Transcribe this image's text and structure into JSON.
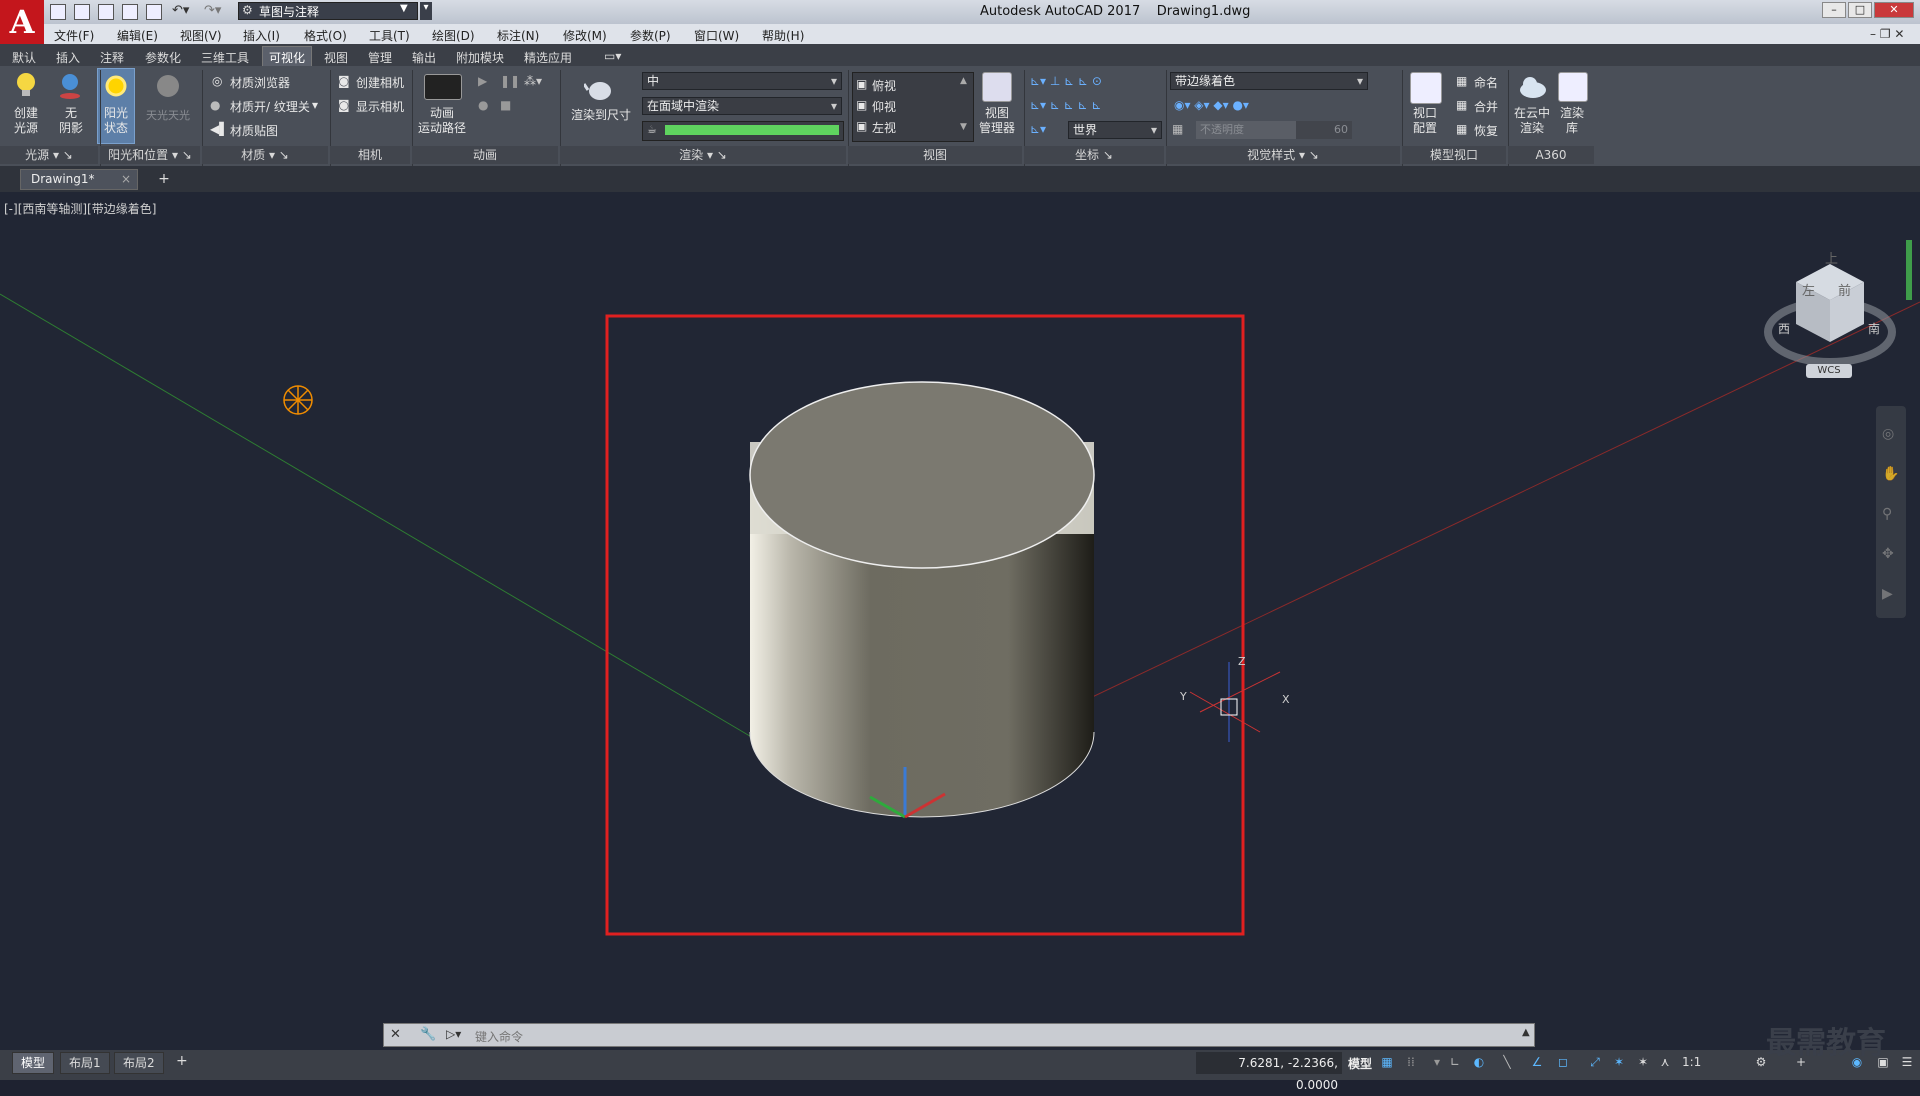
{
  "app": {
    "logo": "A",
    "window_title": "Autodesk AutoCAD 2017    Drawing1.dwg",
    "workspace": "草图与注释"
  },
  "menu": [
    "文件(F)",
    "编辑(E)",
    "视图(V)",
    "插入(I)",
    "格式(O)",
    "工具(T)",
    "绘图(D)",
    "标注(N)",
    "修改(M)",
    "参数(P)",
    "窗口(W)",
    "帮助(H)"
  ],
  "ribbon_tabs": [
    "默认",
    "插入",
    "注释",
    "参数化",
    "三维工具",
    "可视化",
    "视图",
    "管理",
    "输出",
    "附加模块",
    "精选应用"
  ],
  "active_tab": "可视化",
  "ribbon": {
    "lights": {
      "create": "创建\n光源",
      "shadow": "无\n阴影",
      "sun": "阳光\n状态",
      "sky": "天光天光"
    },
    "materials": {
      "browser": "材质浏览器",
      "toggle": "材质开/ 纹理关",
      "mapping": "材质贴图"
    },
    "camera": {
      "create": "创建相机",
      "show": "显示相机"
    },
    "animation": {
      "path": "动画\n运动路径"
    },
    "render": {
      "size": "渲染到尺寸",
      "quality": "中",
      "target": "在面域中渲染"
    },
    "views": {
      "top": "俯视",
      "bottom": "仰视",
      "left": "左视",
      "manager": "视图\n管理器"
    },
    "coords": {
      "world": "世界"
    },
    "visual_style": {
      "style": "带边缘着色",
      "opacity": "不透明度",
      "opacity_value": "60"
    },
    "model_viewports": {
      "config": "视口\n配置",
      "name": "命名",
      "join": "合并",
      "restore": "恢复"
    },
    "a360": {
      "cloud_render": "在云中\n渲染",
      "gallery": "渲染\n库"
    },
    "panels": [
      "光源",
      "阳光和位置",
      "材质",
      "相机",
      "动画",
      "渲染",
      "视图",
      "坐标",
      "视觉样式",
      "模型视口",
      "A360"
    ]
  },
  "file_tab": {
    "name": "Drawing1*",
    "close": "×",
    "add": "+"
  },
  "viewport": {
    "label": "[-][西南等轴测][带边缘着色]",
    "viewcube": {
      "top": "上",
      "front": "前",
      "left": "左",
      "west": "西",
      "south": "南",
      "wcs": "WCS"
    },
    "ucs_labels": {
      "x": "X",
      "y": "Y",
      "z": "Z"
    }
  },
  "command": {
    "placeholder": "键入命令"
  },
  "status": {
    "layouts": [
      "模型",
      "布局1",
      "布局2"
    ],
    "add": "+",
    "coords": "7.6281, -2.2366, 0.0000",
    "model": "模型",
    "scale": "1:1"
  },
  "watermark": "最需教育",
  "colors": {
    "highlight_box": "#e02020",
    "cylinder": "#76746a",
    "accent": "#5cb8ff"
  }
}
